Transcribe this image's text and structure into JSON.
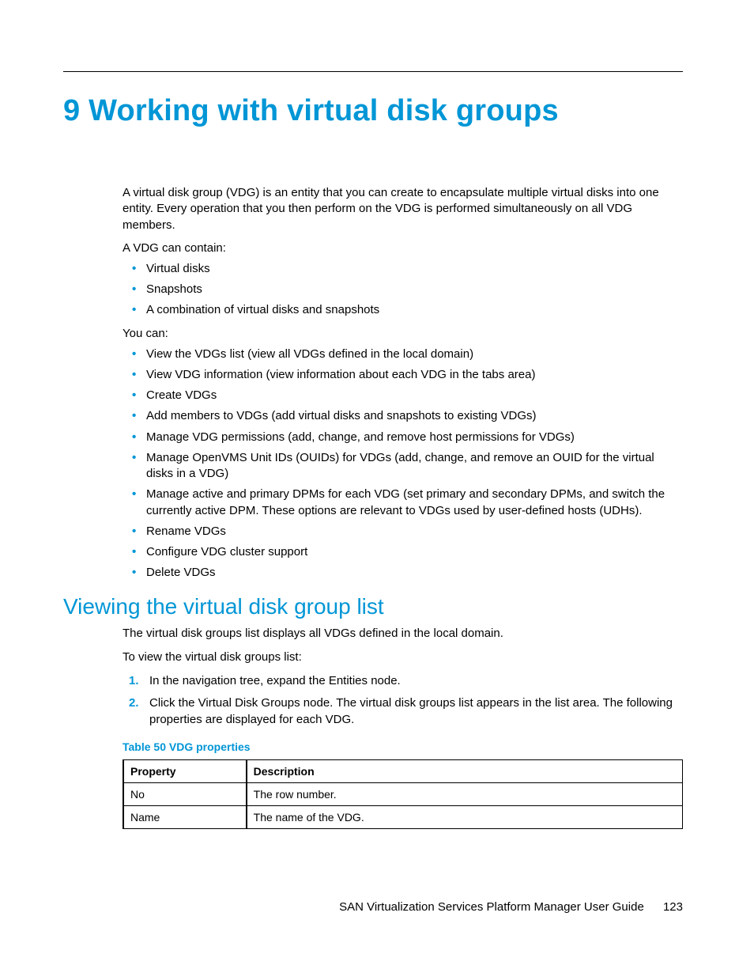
{
  "chapter": {
    "title": "9 Working with virtual disk groups"
  },
  "intro": {
    "p1": "A virtual disk group (VDG) is an entity that you can create to encapsulate multiple virtual disks into one entity. Every operation that you then perform on the VDG is performed simultaneously on all VDG members.",
    "p2": "A VDG can contain:",
    "list1": {
      "i0": "Virtual disks",
      "i1": "Snapshots",
      "i2": "A combination of virtual disks and snapshots"
    },
    "p3": "You can:",
    "list2": {
      "i0": "View the VDGs list (view all VDGs defined in the local domain)",
      "i1": "View VDG information (view information about each VDG in the tabs area)",
      "i2": "Create VDGs",
      "i3": "Add members to VDGs (add virtual disks and snapshots to existing VDGs)",
      "i4": "Manage VDG permissions (add, change, and remove host permissions for VDGs)",
      "i5": "Manage OpenVMS Unit IDs (OUIDs) for VDGs (add, change, and remove an OUID for the virtual disks in a VDG)",
      "i6": "Manage active and primary DPMs for each VDG (set primary and secondary DPMs, and switch the currently active DPM. These options are relevant to VDGs used by user-defined hosts (UDHs).",
      "i7": "Rename VDGs",
      "i8": "Configure VDG cluster support",
      "i9": "Delete VDGs"
    }
  },
  "section": {
    "title": "Viewing the virtual disk group list",
    "p1": "The virtual disk groups list displays all VDGs defined in the local domain.",
    "p2": "To view the virtual disk groups list:",
    "steps": {
      "s0": "In the navigation tree, expand the Entities node.",
      "s1": "Click the Virtual Disk Groups node. The virtual disk groups list appears in the list area. The following properties are displayed for each VDG."
    }
  },
  "table": {
    "caption": "Table 50 VDG properties",
    "headers": {
      "h0": "Property",
      "h1": "Description"
    },
    "rows": {
      "r0": {
        "c0": "No",
        "c1": "The row number."
      },
      "r1": {
        "c0": "Name",
        "c1": "The name of the VDG."
      }
    }
  },
  "footer": {
    "doc": "SAN Virtualization Services Platform Manager User Guide",
    "page": "123"
  }
}
